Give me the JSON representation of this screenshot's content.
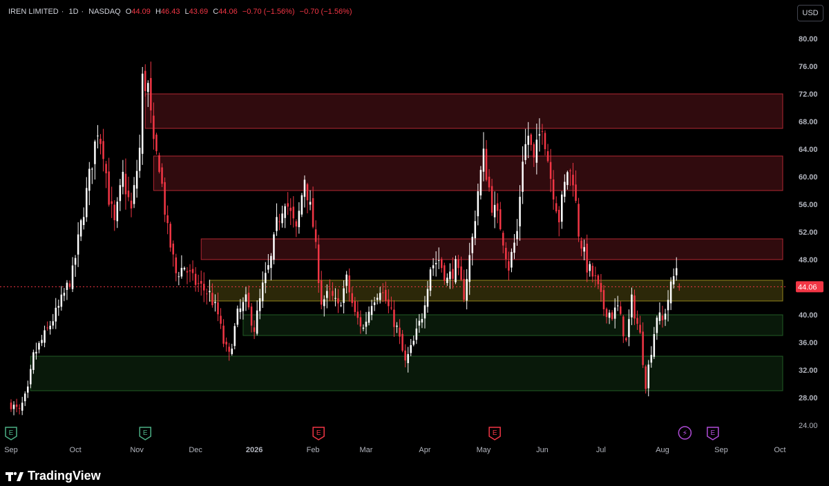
{
  "header": {
    "symbol": "IREN LIMITED",
    "interval": "1D",
    "exchange": "NASDAQ",
    "o_label": "O",
    "o_value": "44.09",
    "h_label": "H",
    "h_value": "46.43",
    "l_label": "L",
    "l_value": "43.69",
    "c_label": "C",
    "c_value": "44.06",
    "change": "−0.70 (−1.56%)",
    "change2": "−0.70 (−1.56%)"
  },
  "currency_button": "USD",
  "brand": "TradingView",
  "colors": {
    "background": "#000000",
    "up": "#ffffff",
    "down": "#f23645",
    "red_zone": "#f23645",
    "yellow_zone": "#c8b428",
    "green_zone": "#2e7d32",
    "earnings_past": "#4caf85",
    "earnings_future": "#f23645",
    "dividend_split": "#b04cd8"
  },
  "chart_data": {
    "type": "candlestick",
    "ylim": [
      22,
      82
    ],
    "y_ticks": [
      "24.00",
      "28.00",
      "32.00",
      "36.00",
      "40.00",
      "44.00",
      "48.00",
      "52.00",
      "56.00",
      "60.00",
      "64.00",
      "68.00",
      "72.00",
      "76.00",
      "80.00"
    ],
    "y_ticks_bold": [
      "28.00",
      "32.00",
      "36.00",
      "40.00",
      "48.00",
      "52.00",
      "56.00",
      "60.00",
      "64.00",
      "68.00",
      "72.00",
      "76.00",
      "80.00"
    ],
    "x_labels": [
      {
        "label": "Sep",
        "t": 0
      },
      {
        "label": "Oct",
        "t": 23
      },
      {
        "label": "Nov",
        "t": 45
      },
      {
        "label": "Dec",
        "t": 66
      },
      {
        "label": "2026",
        "t": 87
      },
      {
        "label": "Feb",
        "t": 108
      },
      {
        "label": "Mar",
        "t": 127
      },
      {
        "label": "Apr",
        "t": 148
      },
      {
        "label": "May",
        "t": 169
      },
      {
        "label": "Jun",
        "t": 190
      },
      {
        "label": "Jul",
        "t": 211
      },
      {
        "label": "Aug",
        "t": 233
      },
      {
        "label": "Sep",
        "t": 254
      },
      {
        "label": "Oct",
        "t": 275
      }
    ],
    "x_labels_bold": [
      "2026"
    ],
    "last_price": 44.06,
    "last_price_label": "44.06",
    "zones": [
      {
        "type": "resistance",
        "t0": 48,
        "t1": 276,
        "low": 67,
        "high": 72
      },
      {
        "type": "resistance",
        "t0": 51,
        "t1": 276,
        "low": 58,
        "high": 63
      },
      {
        "type": "resistance",
        "t0": 68,
        "t1": 276,
        "low": 48,
        "high": 51
      },
      {
        "type": "pivot",
        "t0": 71,
        "t1": 276,
        "low": 42,
        "high": 45
      },
      {
        "type": "support",
        "t0": 83,
        "t1": 276,
        "low": 37,
        "high": 40
      },
      {
        "type": "support",
        "t0": 7,
        "t1": 276,
        "low": 29,
        "high": 34
      }
    ],
    "events": [
      {
        "t": 0,
        "kind": "earnings-past",
        "label": "E"
      },
      {
        "t": 48,
        "kind": "earnings-past",
        "label": "E"
      },
      {
        "t": 110,
        "kind": "earnings-future",
        "label": "E"
      },
      {
        "t": 173,
        "kind": "earnings-future",
        "label": "E"
      },
      {
        "t": 241,
        "kind": "split",
        "label": "⚡"
      },
      {
        "t": 251,
        "kind": "dividend",
        "label": "E"
      }
    ],
    "anchors": [
      [
        0,
        27
      ],
      [
        3,
        26
      ],
      [
        6,
        29
      ],
      [
        8,
        34
      ],
      [
        12,
        37
      ],
      [
        17,
        41
      ],
      [
        22,
        46
      ],
      [
        25,
        53
      ],
      [
        28,
        60
      ],
      [
        31,
        67
      ],
      [
        33,
        64
      ],
      [
        35,
        57
      ],
      [
        37,
        53
      ],
      [
        40,
        60
      ],
      [
        43,
        55
      ],
      [
        46,
        64
      ],
      [
        47,
        74
      ],
      [
        49,
        73
      ],
      [
        51,
        64
      ],
      [
        53,
        62
      ],
      [
        56,
        52
      ],
      [
        59,
        46
      ],
      [
        62,
        47
      ],
      [
        65,
        45
      ],
      [
        68,
        44
      ],
      [
        71,
        43
      ],
      [
        74,
        40
      ],
      [
        76,
        36
      ],
      [
        78,
        34
      ],
      [
        81,
        40
      ],
      [
        84,
        42
      ],
      [
        87,
        38
      ],
      [
        90,
        44
      ],
      [
        93,
        48
      ],
      [
        95,
        53
      ],
      [
        98,
        57
      ],
      [
        102,
        52
      ],
      [
        105,
        60
      ],
      [
        108,
        53
      ],
      [
        111,
        42
      ],
      [
        114,
        43
      ],
      [
        117,
        41
      ],
      [
        120,
        45
      ],
      [
        123,
        40
      ],
      [
        126,
        38
      ],
      [
        129,
        42
      ],
      [
        132,
        44
      ],
      [
        135,
        41
      ],
      [
        138,
        38
      ],
      [
        141,
        33
      ],
      [
        144,
        36
      ],
      [
        147,
        40
      ],
      [
        150,
        47
      ],
      [
        153,
        48
      ],
      [
        156,
        45
      ],
      [
        159,
        47
      ],
      [
        162,
        43
      ],
      [
        165,
        51
      ],
      [
        167,
        58
      ],
      [
        169,
        63
      ],
      [
        172,
        56
      ],
      [
        175,
        53
      ],
      [
        178,
        47
      ],
      [
        181,
        52
      ],
      [
        183,
        63
      ],
      [
        185,
        66
      ],
      [
        187,
        62
      ],
      [
        190,
        68
      ],
      [
        193,
        60
      ],
      [
        196,
        54
      ],
      [
        199,
        61
      ],
      [
        201,
        60
      ],
      [
        203,
        52
      ],
      [
        206,
        47
      ],
      [
        209,
        45
      ],
      [
        212,
        41
      ],
      [
        215,
        40
      ],
      [
        217,
        41
      ],
      [
        220,
        36
      ],
      [
        222,
        42
      ],
      [
        225,
        37
      ],
      [
        227,
        30
      ],
      [
        229,
        35
      ],
      [
        231,
        40
      ],
      [
        233,
        39
      ],
      [
        236,
        44
      ],
      [
        238,
        47
      ],
      [
        239,
        44.06
      ]
    ]
  }
}
